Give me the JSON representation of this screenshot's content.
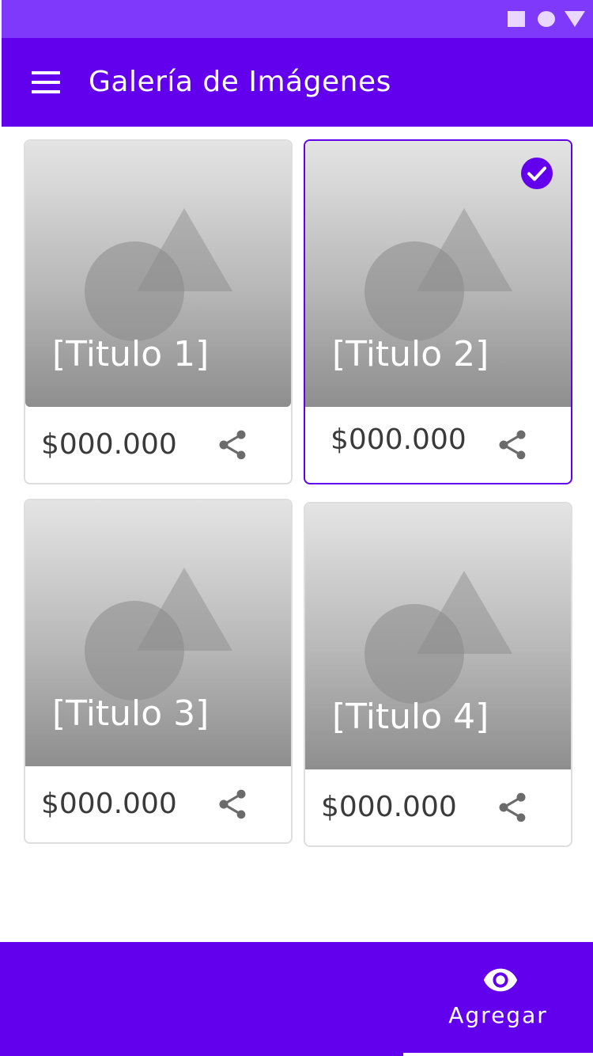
{
  "status_bar": {
    "icons": [
      "square-icon",
      "circle-icon",
      "triangle-icon"
    ]
  },
  "app_bar": {
    "title": "Galería de Imágenes",
    "menu_icon": "menu-icon"
  },
  "cards": [
    {
      "title": "[Titulo 1]",
      "price": "$000.000",
      "selected": false
    },
    {
      "title": "[Titulo 2]",
      "price": "$000.000",
      "selected": true
    },
    {
      "title": "[Titulo 3]",
      "price": "$000.000",
      "selected": false
    },
    {
      "title": "[Titulo 4]",
      "price": "$000.000",
      "selected": false
    }
  ],
  "bottom_bar": {
    "action_label": "Agregar",
    "action_icon": "eye-icon"
  },
  "colors": {
    "primary": "#6200ee",
    "status_bar": "#7f39fb",
    "on_primary": "#ffffff"
  }
}
